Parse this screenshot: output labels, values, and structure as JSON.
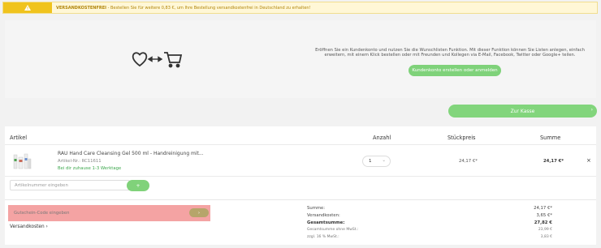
{
  "notice": {
    "bold": "VERSANDKOSTENFREI",
    "text": " - Bestellen Sie für weitere 0,83 €, um Ihre Bestellung versandkostenfrei in Deutschland zu erhalten!"
  },
  "wishlist": {
    "message": "Eröffnen Sie ein Kundenkonto und nutzen Sie die Wunschlisten Funktion. Mit dieser Funktion können Sie Listen anlegen, einfach erweitern, mit einem Klick bestellen oder mit Freunden und Kollegen via E-Mail, Facebook, Twitter oder Google+ teilen.",
    "button": "Kundenkonto erstellen oder anmelden"
  },
  "checkout": {
    "label": "Zur Kasse",
    "chevron": "›"
  },
  "cart": {
    "headers": {
      "article": "Artikel",
      "qty": "Anzahl",
      "unit": "Stückpreis",
      "sum": "Summe"
    },
    "item": {
      "name": "RAU Hand Care Cleansing Gel 500 ml - Handreinigung mit...",
      "number": "Artikel-Nr.: RC11611",
      "delivery": "Bei dir zuhause 1-3 Werktage",
      "qty": "1",
      "unit_price": "24,17 €*",
      "sum": "24,17 €*",
      "remove": "×"
    },
    "article_input_placeholder": "Artikelnummer eingeben",
    "article_add": "+"
  },
  "voucher": {
    "placeholder": "Gutschein-Code eingeben",
    "button": "›"
  },
  "shipping_label": "Versandkosten ›",
  "totals": [
    {
      "label": "Summe:",
      "value": "24,17 €*"
    },
    {
      "label": "Versandkosten:",
      "value": "3,65 €*"
    },
    {
      "label": "Gesamtsumme:",
      "value": "27,82 €"
    },
    {
      "label": "Gesamtsumme ohne MwSt.:",
      "value": "23,99 €"
    },
    {
      "label": "zzgl. 16 % MwSt.:",
      "value": "3,83 €"
    }
  ],
  "colors": {
    "accent": "#7fd27a",
    "warning": "#f0c31d",
    "voucher_bg": "#f4a3a3"
  },
  "icons": [
    "warning-icon",
    "heart-icon",
    "arrows-icon",
    "cart-icon",
    "chevron-down-icon",
    "close-icon"
  ]
}
